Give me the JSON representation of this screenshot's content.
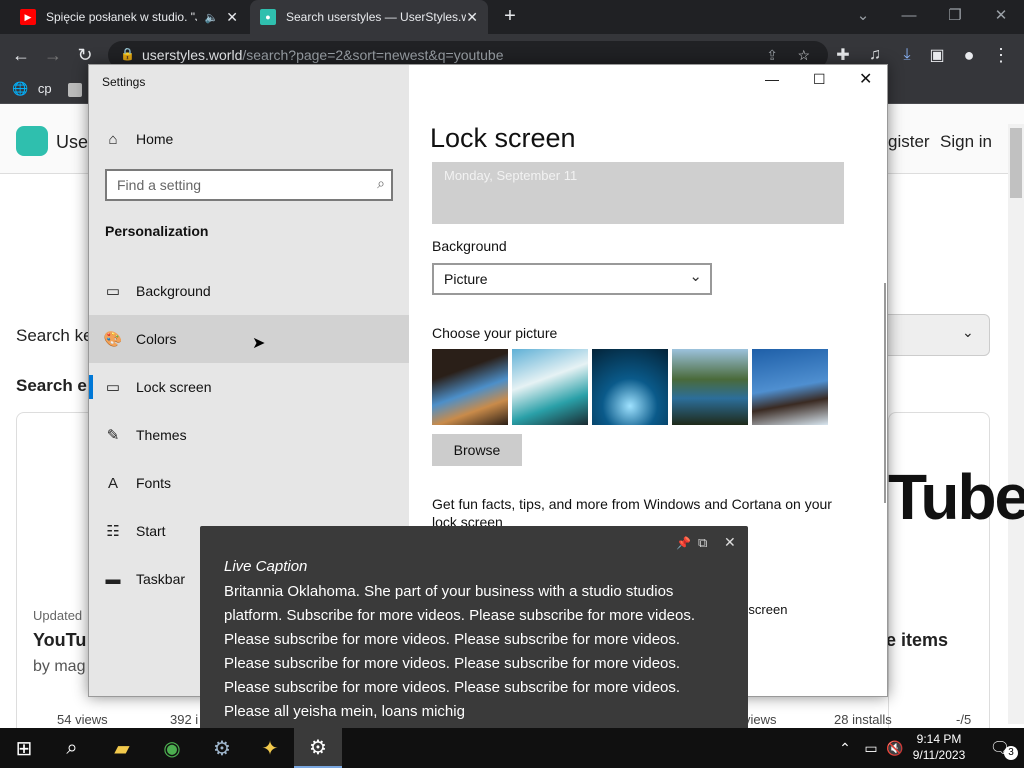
{
  "browser": {
    "tabs": [
      {
        "title": "Spięcie posłanek w studio. \"J",
        "icon": "youtube-icon"
      },
      {
        "title": "Search userstyles — UserStyles.w",
        "icon": "userstyles-icon"
      }
    ],
    "new_tab": "+",
    "url_host": "userstyles.world",
    "url_rest": "/search?page=2&sort=newest&q=youtube",
    "bookmarks": [
      {
        "label": "cp"
      }
    ]
  },
  "webpage": {
    "brand": "Use",
    "register": "gister",
    "sign_in": "Sign in",
    "search_label": "Search ke",
    "search_heading": "Search er",
    "card_left": {
      "updated": "Updated",
      "title": "YouTu",
      "by": "by mag",
      "views": "54 views",
      "installs": "392 i"
    },
    "card_right": {
      "title": "e items",
      "views": "views",
      "installs": "28 installs",
      "rating": "-/5"
    },
    "big_text": "Tube"
  },
  "settings": {
    "window_title": "Settings",
    "home": "Home",
    "search_placeholder": "Find a setting",
    "section": "Personalization",
    "nav": [
      {
        "label": "Background",
        "icon": "picture-icon"
      },
      {
        "label": "Colors",
        "icon": "palette-icon"
      },
      {
        "label": "Lock screen",
        "icon": "lock-screen-icon"
      },
      {
        "label": "Themes",
        "icon": "themes-icon"
      },
      {
        "label": "Fonts",
        "icon": "fonts-icon"
      },
      {
        "label": "Start",
        "icon": "start-icon"
      },
      {
        "label": "Taskbar",
        "icon": "taskbar-icon"
      }
    ],
    "page_title": "Lock screen",
    "preview_date": "Monday, September 11",
    "background_label": "Background",
    "background_value": "Picture",
    "choose_label": "Choose your picture",
    "browse": "Browse",
    "fun_facts": "Get fun facts, tips, and more from Windows and Cortana on your lock screen",
    "toggle_state": "On",
    "partial_text": "the lock screen"
  },
  "live_caption": {
    "title": "Live Caption",
    "lines": [
      "Britannia Oklahoma. She part of your business with a studio studios",
      "platform. Subscribe for more videos. Please subscribe for more videos.",
      "Please subscribe for more videos. Please subscribe for more videos.",
      "Please subscribe for more videos. Please subscribe for more videos.",
      "Please subscribe for more videos. Please subscribe for more videos.",
      "Please all yeisha mein, loans michig"
    ]
  },
  "taskbar": {
    "time": "9:14 PM",
    "date": "9/11/2023",
    "notifications": "3"
  }
}
